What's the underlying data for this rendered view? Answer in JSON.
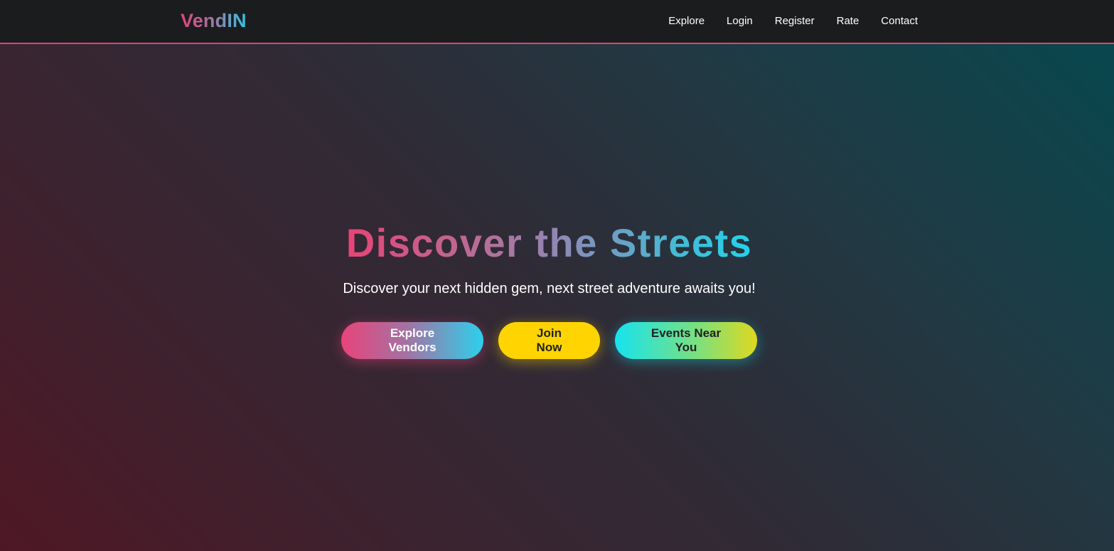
{
  "brand": {
    "name": "VendIN",
    "accent_pink": "#e0456f",
    "accent_cyan": "#2fc6e6"
  },
  "nav": {
    "items": [
      {
        "label": "Explore"
      },
      {
        "label": "Login"
      },
      {
        "label": "Register"
      },
      {
        "label": "Rate"
      },
      {
        "label": "Contact"
      }
    ]
  },
  "hero": {
    "title": "Discover the Streets",
    "subtitle": "Discover your next hidden gem, next street adventure awaits you!",
    "buttons": {
      "explore": "Explore Vendors",
      "join": "Join Now",
      "events": "Events Near You"
    },
    "button_colors": {
      "join": "#ffd400"
    }
  }
}
